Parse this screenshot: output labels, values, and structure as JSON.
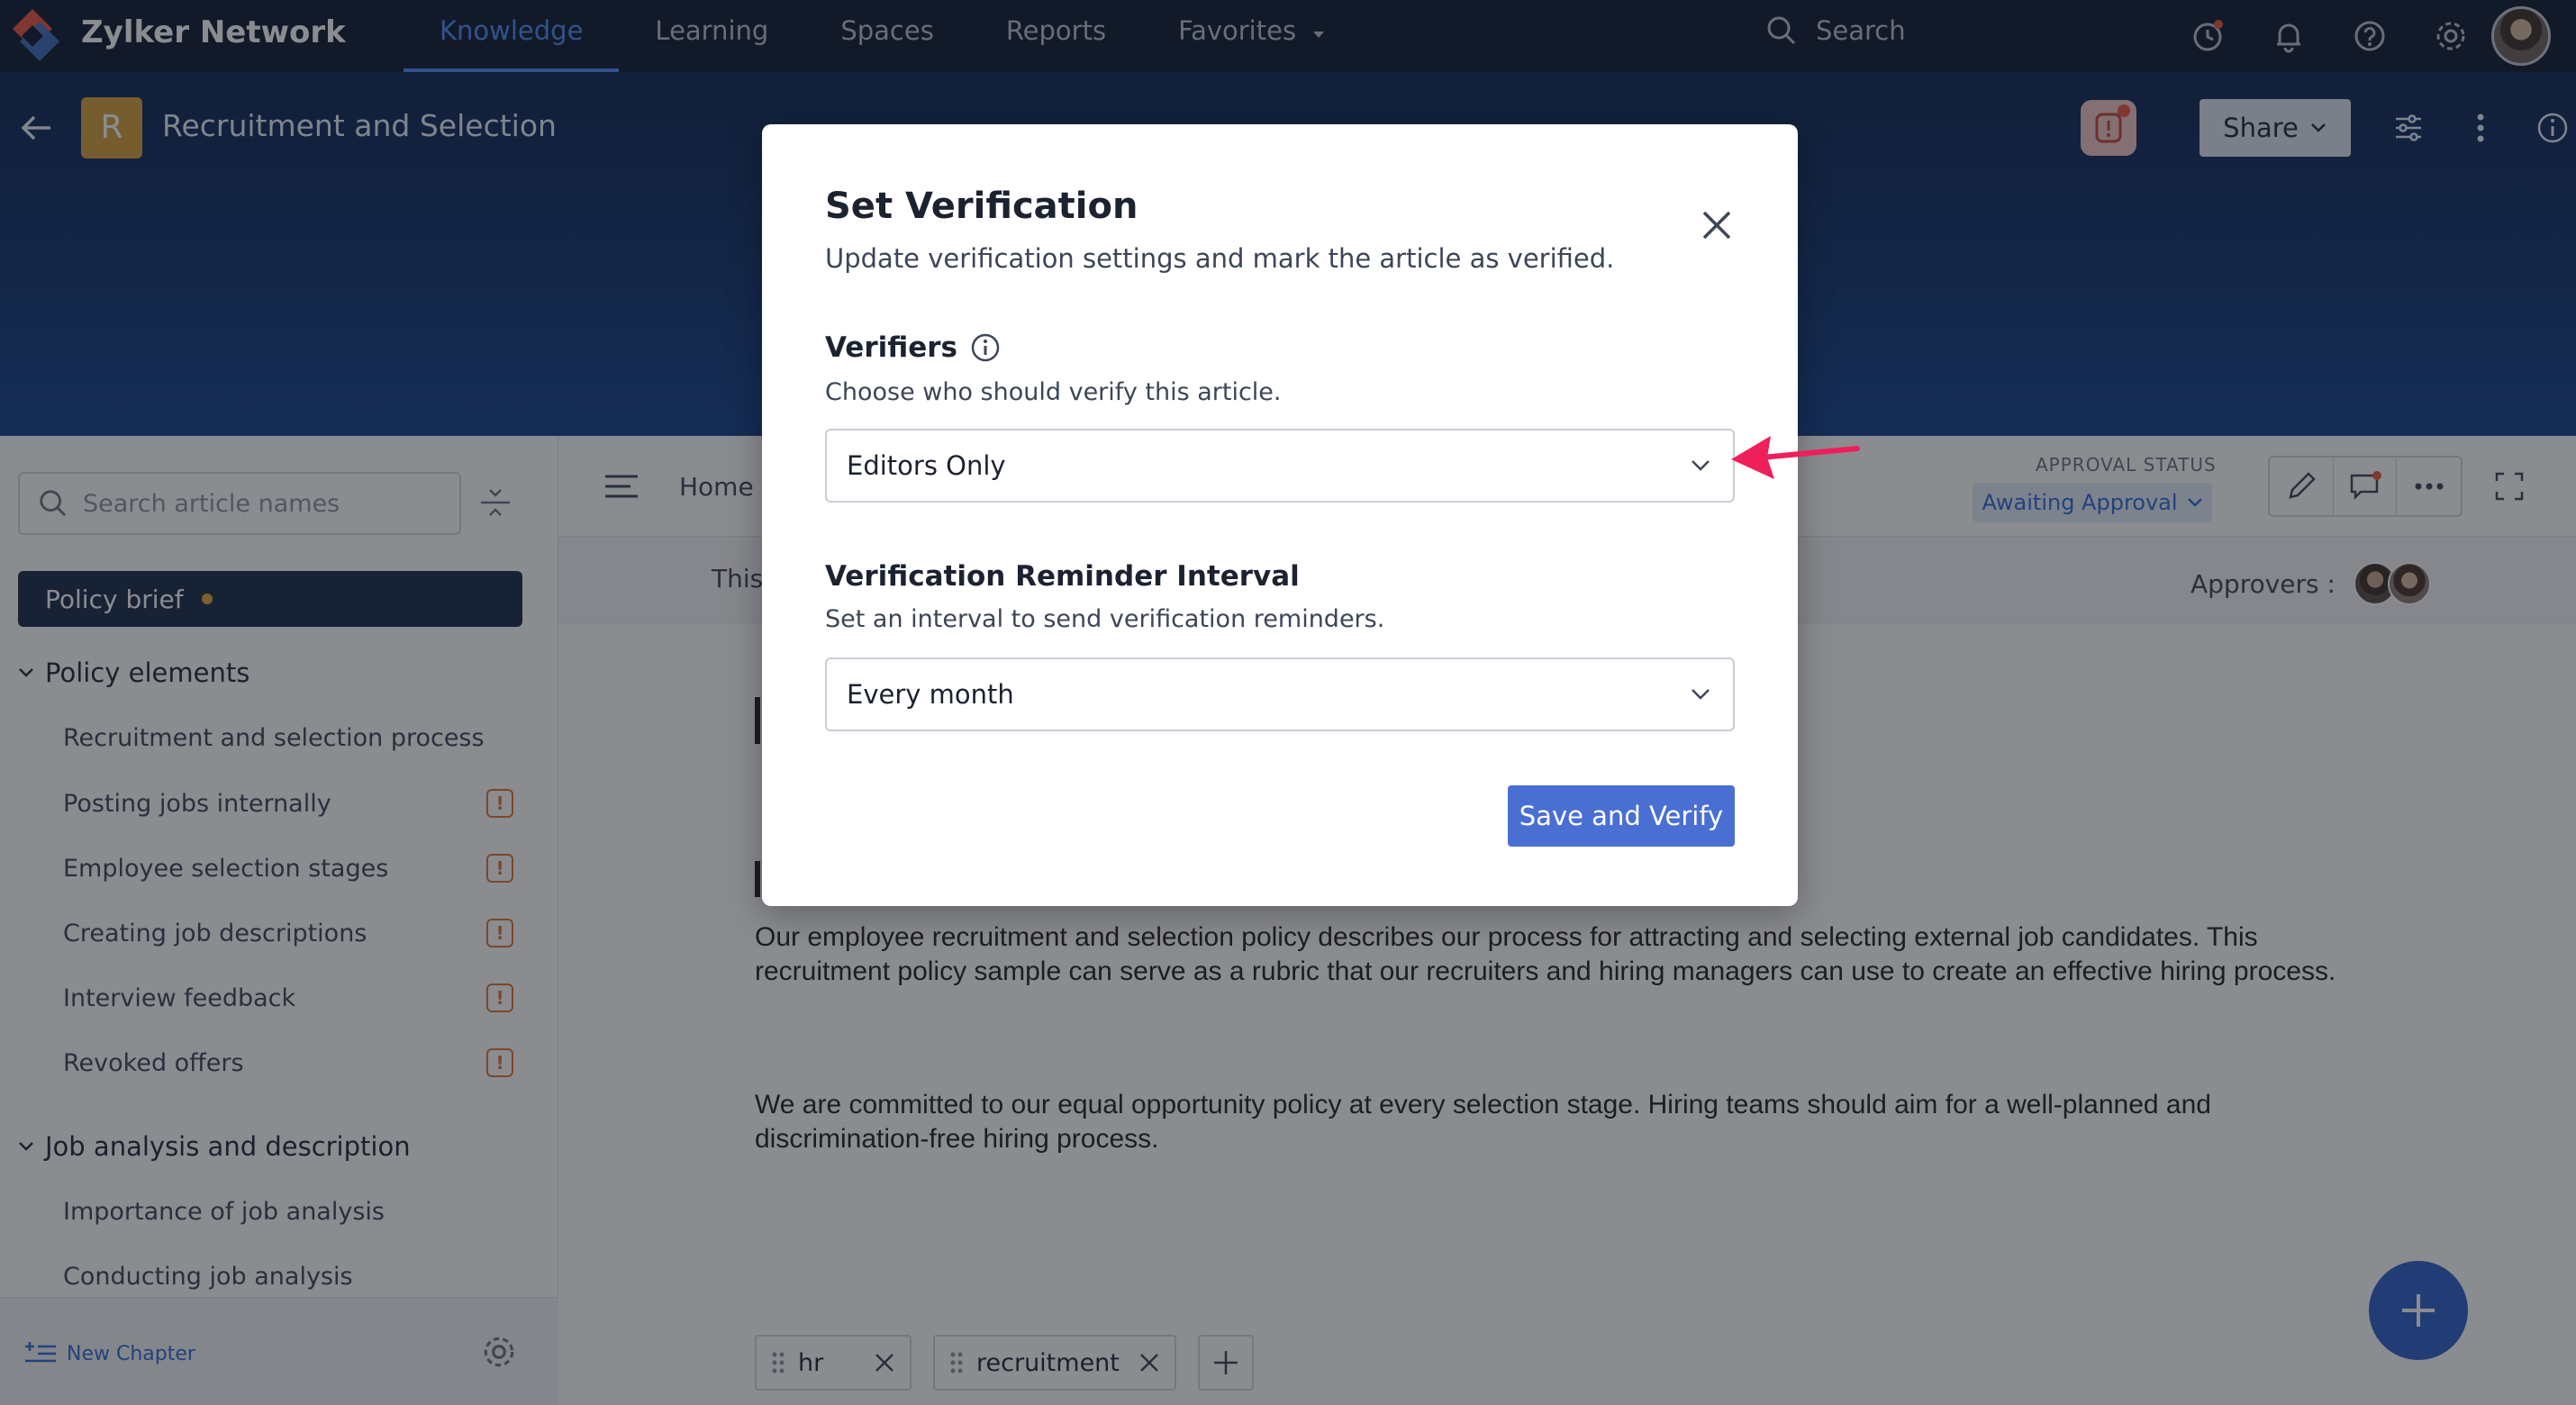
{
  "topnav": {
    "brand": "Zylker Network",
    "links": [
      "Knowledge",
      "Learning",
      "Spaces",
      "Reports",
      "Favorites"
    ],
    "active_link": "Knowledge",
    "search_label": "Search"
  },
  "hero": {
    "space_initial": "R",
    "space_title": "Recruitment and Selection",
    "share_label": "Share"
  },
  "sidebar": {
    "search_placeholder": "Search article names",
    "active_item": "Policy brief",
    "sections": [
      {
        "title": "Policy elements",
        "items": [
          {
            "label": "Recruitment and selection process",
            "warning": false
          },
          {
            "label": "Posting jobs internally",
            "warning": true
          },
          {
            "label": "Employee selection stages",
            "warning": true
          },
          {
            "label": "Creating job descriptions",
            "warning": true
          },
          {
            "label": "Interview feedback",
            "warning": true
          },
          {
            "label": "Revoked offers",
            "warning": true
          }
        ]
      },
      {
        "title": "Job analysis and description",
        "items": [
          {
            "label": "Importance of job analysis",
            "warning": false
          },
          {
            "label": "Conducting job analysis",
            "warning": false
          }
        ]
      }
    ],
    "warning_glyph": "!",
    "new_chapter_label": "New Chapter"
  },
  "content": {
    "breadcrumb": "Home",
    "approval_label": "APPROVAL STATUS",
    "approval_status": "Awaiting Approval",
    "info_text": "This",
    "approvers_label": "Approvers :",
    "paragraph1": "Our employee recruitment and selection policy describes our process for attracting and selecting external job candidates. This recruitment policy sample can serve as a rubric that our recruiters and hiring managers can use to create an effective hiring process.",
    "paragraph2": "We are committed to our equal opportunity policy at every selection stage. Hiring teams should aim for a well-planned and discrimination-free hiring process.",
    "tags": [
      "hr",
      "recruitment"
    ]
  },
  "modal": {
    "title": "Set Verification",
    "subtitle": "Update verification settings and mark the article as verified.",
    "verifiers_label": "Verifiers",
    "verifiers_help": "Choose who should verify this article.",
    "verifiers_value": "Editors Only",
    "interval_label": "Verification Reminder Interval",
    "interval_help": "Set an interval to send verification reminders.",
    "interval_value": "Every month",
    "save_label": "Save and Verify"
  },
  "colors": {
    "nav_bg": "#0f1a31",
    "accent": "#4c8cf5",
    "primary_button": "#4a6fd3",
    "annotation_arrow": "#ee1f5a",
    "warning": "#e0772e"
  }
}
